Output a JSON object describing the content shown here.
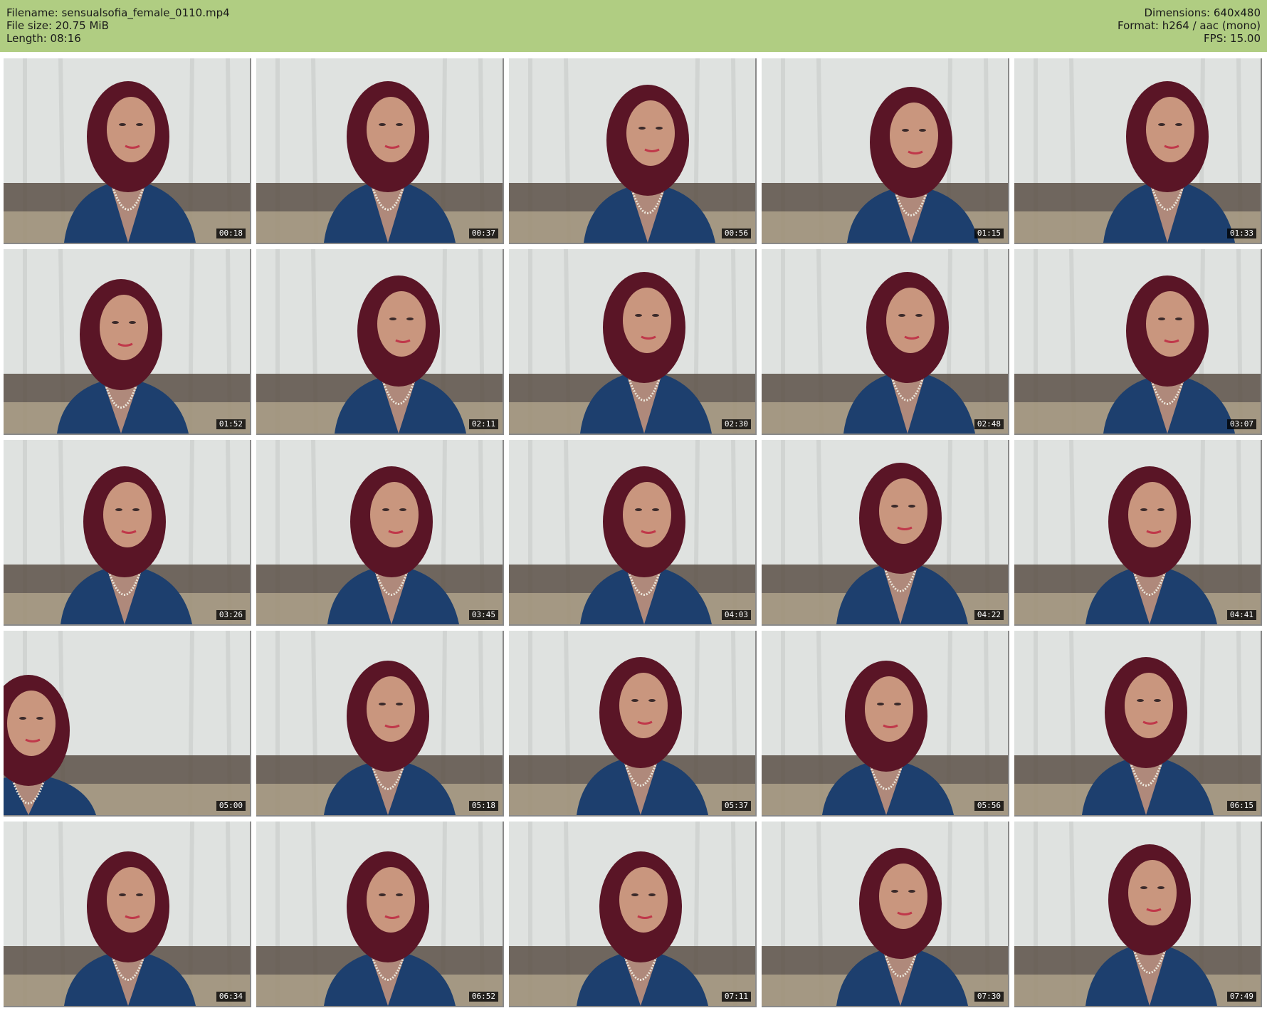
{
  "header": {
    "filename": "Filename: sensualsofia_female_0110.mp4",
    "file_size": "File size: 20.75 MiB",
    "length": "Length: 08:16",
    "dimensions": "Dimensions: 640x480",
    "format": "Format: h264 / aac (mono)",
    "fps": "FPS: 15.00"
  },
  "colors": {
    "header_bg": "#b0cd82",
    "curtain": "#dfe2e0",
    "sofa": "#5c5047",
    "hair": "#5a1526",
    "jacket": "#1d3f6e",
    "skin": "#c9967e",
    "pearls": "#ece7dc"
  },
  "thumbnails": [
    {
      "time": "00:18"
    },
    {
      "time": "00:37"
    },
    {
      "time": "00:56"
    },
    {
      "time": "01:15"
    },
    {
      "time": "01:33"
    },
    {
      "time": "01:52"
    },
    {
      "time": "02:11"
    },
    {
      "time": "02:30"
    },
    {
      "time": "02:48"
    },
    {
      "time": "03:07"
    },
    {
      "time": "03:26"
    },
    {
      "time": "03:45"
    },
    {
      "time": "04:03"
    },
    {
      "time": "04:22"
    },
    {
      "time": "04:41"
    },
    {
      "time": "05:00"
    },
    {
      "time": "05:18"
    },
    {
      "time": "05:37"
    },
    {
      "time": "05:56"
    },
    {
      "time": "06:15"
    },
    {
      "time": "06:34"
    },
    {
      "time": "06:52"
    },
    {
      "time": "07:11"
    },
    {
      "time": "07:30"
    },
    {
      "time": "07:49"
    }
  ]
}
